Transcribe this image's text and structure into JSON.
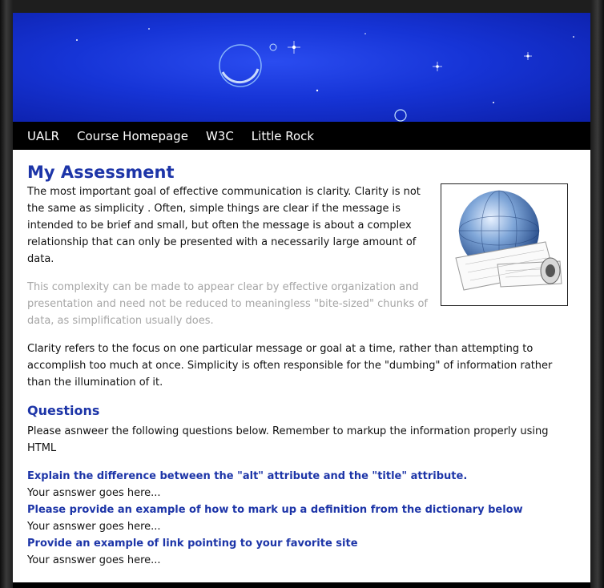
{
  "nav": {
    "items": [
      "UALR",
      "Course Homepage",
      "W3C",
      "Little Rock"
    ]
  },
  "main": {
    "title": "My Assessment",
    "paragraph1": "The most important goal of effective communication is clarity. Clarity is not the same as simplicity . Often, simple things are clear if the message is intended to be brief and small, but often the message is about a complex relationship that can only be presented with a necessarily large amount of data.",
    "paragraph2": "This complexity can be made to appear clear by effective organization and presentation and need not be reduced to meaningless \"bite-sized\" chunks of data, as simplification usually does.",
    "paragraph3": "Clarity refers to the focus on one particular message or goal at a time, rather than attempting to accomplish too much at once. Simplicity is often responsible for the \"dumbing\" of information rather than the illumination of it."
  },
  "questions": {
    "heading": "Questions",
    "instructions": "Please asnweer the following questions below. Remember to markup the information properly using HTML",
    "items": [
      {
        "question": "Explain the difference between the \"alt\" attribute and the \"title\" attribute.",
        "answer": "Your asnswer goes here..."
      },
      {
        "question": "Please provide an example of how to mark up a definition from the dictionary below",
        "answer": "Your asnswer goes here..."
      },
      {
        "question": "Provide an example of link pointing to your favorite site",
        "answer": "Your asnswer goes here..."
      }
    ]
  },
  "colors": {
    "heading": "#1d35a8",
    "nav_bg": "#000000",
    "muted_text": "#a6a6a6",
    "banner": "#1634d6"
  },
  "icons": {
    "figure": "globe-with-blueprint-scrolls"
  }
}
